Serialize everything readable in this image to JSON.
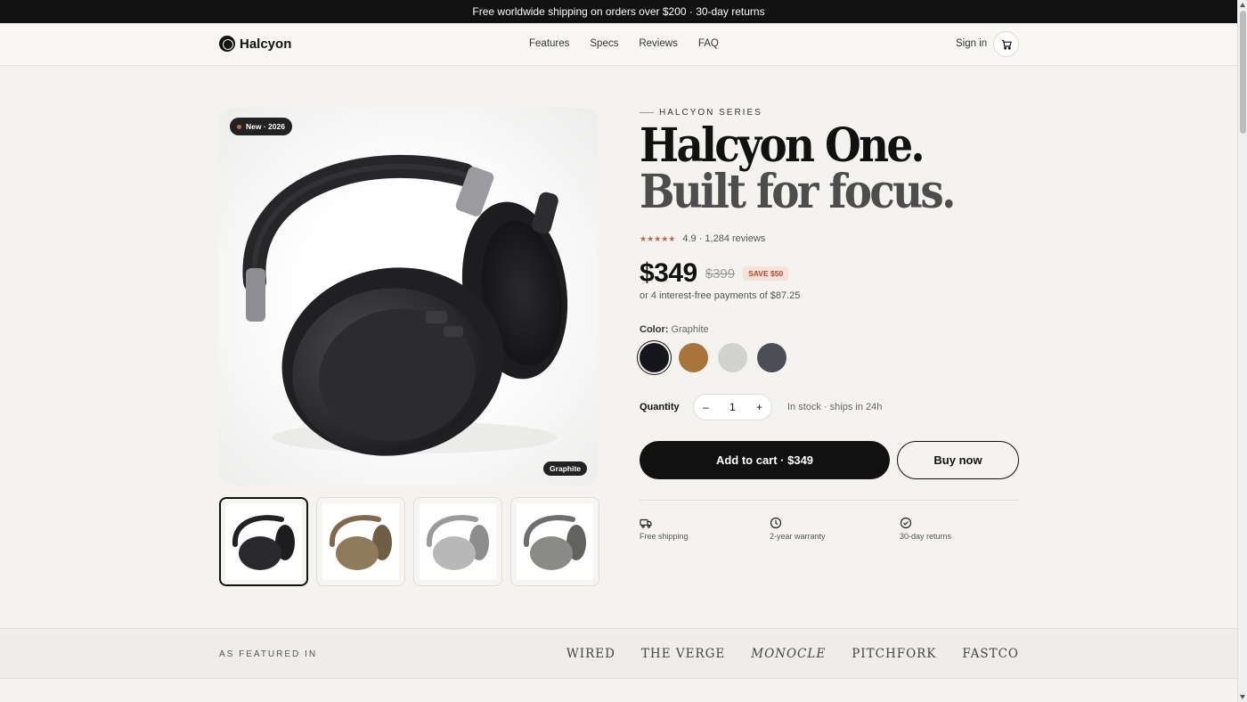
{
  "announcement": "Free worldwide shipping on orders over $200 · 30-day returns",
  "brand": "Halcyon",
  "nav": {
    "links": [
      "Features",
      "Specs",
      "Reviews",
      "FAQ"
    ],
    "sign_in": "Sign in",
    "cart_icon": "cart-icon"
  },
  "gallery": {
    "badge": "New · 2026",
    "color_tag": "Graphite",
    "thumbnails": [
      "Graphite",
      "Bronze",
      "Silver",
      "Slate"
    ],
    "active_index": 0
  },
  "product": {
    "eyebrow": "HALCYON SERIES",
    "title_line1": "Halcyon One.",
    "title_line2": "Built for focus.",
    "stars": "★★★★★",
    "rating": "4.9 · 1,284 reviews",
    "price": "$349",
    "old_price": "$399",
    "save": "SAVE $50",
    "installments": "or 4 interest-free payments of $87.25",
    "color_label": "Color:",
    "color_value": "Graphite",
    "swatches": [
      {
        "name": "Graphite",
        "color": "#15161b"
      },
      {
        "name": "Bronze",
        "color": "#a8743a"
      },
      {
        "name": "Silver",
        "color": "#d2d2d0"
      },
      {
        "name": "Slate",
        "color": "#4c4e56"
      }
    ],
    "quantity_label": "Quantity",
    "quantity": "1",
    "minus": "–",
    "plus": "+",
    "stock": "In stock · ships in 24h",
    "add_to_cart": "Add to cart · $349",
    "buy_now": "Buy now",
    "perks": [
      {
        "icon": "truck-icon",
        "label": "Free shipping"
      },
      {
        "icon": "clock-icon",
        "label": "2-year warranty"
      },
      {
        "icon": "check-circle-icon",
        "label": "30-day returns"
      }
    ]
  },
  "featured": {
    "label": "AS FEATURED IN",
    "publications": [
      "WIRED",
      "THE VERGE",
      "MONOCLE",
      "PITCHFORK",
      "FASTCO"
    ]
  },
  "colors": {
    "accent": "#c2654a",
    "ink": "#111111",
    "background": "#f4f3ef"
  }
}
